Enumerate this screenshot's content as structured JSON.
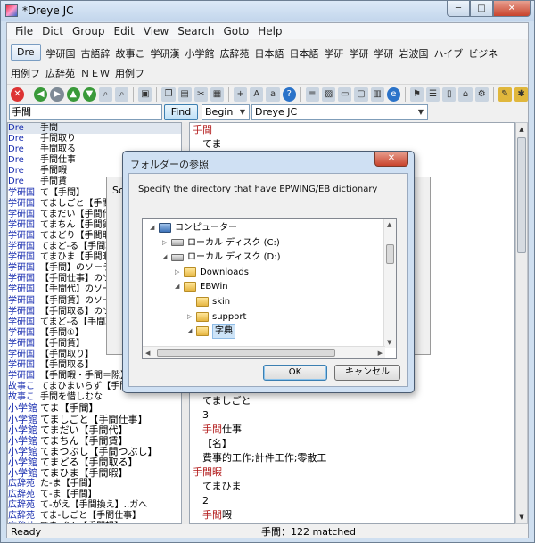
{
  "window": {
    "title": "*Dreye JC",
    "buttons": [
      "─",
      "□",
      "✕"
    ]
  },
  "menu": [
    "File",
    "Dict",
    "Group",
    "Edit",
    "View",
    "Search",
    "Goto",
    "Help"
  ],
  "dicts_line1": [
    "Dre",
    "学研国",
    "古語辞",
    "故事こ",
    "学研漢",
    "小学館",
    "広辞苑",
    "日本語",
    "日本語",
    "学研",
    "学研",
    "学研",
    "岩波国",
    "ハイブ",
    "ビジネ"
  ],
  "dicts_line2": [
    "用例フ",
    "広辞苑",
    "ＮＥＷ",
    "用例フ"
  ],
  "search": {
    "value": "手間",
    "find_label": "Find",
    "mode": "Begin",
    "dictionary": "Dreye JC"
  },
  "left_list": [
    {
      "d": "Dre",
      "w": "手間",
      "sel": true
    },
    {
      "d": "Dre",
      "w": "手間取り"
    },
    {
      "d": "Dre",
      "w": "手間取る"
    },
    {
      "d": "Dre",
      "w": "手間仕事"
    },
    {
      "d": "Dre",
      "w": "手間暇"
    },
    {
      "d": "Dre",
      "w": "手間賃"
    },
    {
      "d": "学研国",
      "w": "て【手間】"
    },
    {
      "d": "学研国",
      "w": "てましごと【手間仕事】"
    },
    {
      "d": "学研国",
      "w": "てまだい【手間代】"
    },
    {
      "d": "学研国",
      "w": "てまちん【手間賃】"
    },
    {
      "d": "学研国",
      "w": "てまどり【手間取り】"
    },
    {
      "d": "学研国",
      "w": "てまど-る【手間取る】"
    },
    {
      "d": "学研国",
      "w": "てまひま【手間暇・手間隙】"
    },
    {
      "d": "学研国",
      "w": "【手間】のソーラス"
    },
    {
      "d": "学研国",
      "w": "【手間仕事】のソ"
    },
    {
      "d": "学研国",
      "w": "【手間代】のソーラス"
    },
    {
      "d": "学研国",
      "w": "【手間賃】のソーラス"
    },
    {
      "d": "学研国",
      "w": "【手間取る】のソ"
    },
    {
      "d": "学研国",
      "w": "てまど-る【手間取る】"
    },
    {
      "d": "学研国",
      "w": "【手間①】"
    },
    {
      "d": "学研国",
      "w": "【手間賃】"
    },
    {
      "d": "学研国",
      "w": "【手間取り】"
    },
    {
      "d": "学研国",
      "w": "【手間取る】"
    },
    {
      "d": "学研国",
      "w": "【手間暇・手間＝隙】"
    },
    {
      "d": "故事こ",
      "w": "てまひまいらず【手間隙】"
    },
    {
      "d": "故事こ",
      "w": "手間を惜しむな"
    },
    {
      "d": "小学館",
      "w": "てま【手間】",
      "big": true
    },
    {
      "d": "小学館",
      "w": "てましごと【手間仕事】",
      "big": true
    },
    {
      "d": "小学館",
      "w": "てまだい【手間代】",
      "big": true
    },
    {
      "d": "小学館",
      "w": "てまちん【手間賃】",
      "big": true
    },
    {
      "d": "小学館",
      "w": "てまつぶし【手間つぶし】",
      "big": true
    },
    {
      "d": "小学館",
      "w": "てまどる【手間取る】",
      "big": true
    },
    {
      "d": "小学館",
      "w": "てまひま【手間暇】",
      "big": true
    },
    {
      "d": "広辞苑",
      "w": "た-ま【手間】"
    },
    {
      "d": "広辞苑",
      "w": "て-ま【手間】"
    },
    {
      "d": "広辞苑",
      "w": "て-がえ【手間換え】‥ガへ"
    },
    {
      "d": "広辞苑",
      "w": "てま-しごと【手間仕事】"
    },
    {
      "d": "広辞苑",
      "w": "てま-ぞん【手間損】"
    }
  ],
  "right_pane": [
    {
      "t": "head",
      "text": "手間"
    },
    {
      "t": "body",
      "text": "てま"
    },
    {
      "t": "spacer"
    },
    {
      "t": "spacer"
    },
    {
      "t": "spacer"
    },
    {
      "t": "spacer"
    },
    {
      "t": "spacer"
    },
    {
      "t": "spacer"
    },
    {
      "t": "spacer"
    },
    {
      "t": "spacer"
    },
    {
      "t": "spacer"
    },
    {
      "t": "spacer"
    },
    {
      "t": "spacer"
    },
    {
      "t": "spacer"
    },
    {
      "t": "spacer"
    },
    {
      "t": "spacer"
    },
    {
      "t": "spacer"
    },
    {
      "t": "spacer"
    },
    {
      "t": "spacer"
    },
    {
      "t": "body",
      "text": "てましごと"
    },
    {
      "t": "body",
      "text": "3"
    },
    {
      "t": "body",
      "parts": [
        [
          "手間",
          true
        ],
        [
          "仕事",
          false
        ]
      ]
    },
    {
      "t": "body",
      "text": "【名】"
    },
    {
      "t": "body",
      "text": "費事的工作;計件工作;零散工"
    },
    {
      "t": "head",
      "text": "手間暇"
    },
    {
      "t": "body",
      "text": "てまひま"
    },
    {
      "t": "body",
      "text": "2"
    },
    {
      "t": "body",
      "parts": [
        [
          "手間",
          true
        ],
        [
          "暇",
          false
        ]
      ]
    }
  ],
  "status": {
    "left": "Ready",
    "mid": "手間：122 matched"
  },
  "behind_dialog": {
    "title_fragment": "So"
  },
  "folder_dialog": {
    "title": "フォルダーの参照",
    "description": "Specify the directory that have EPWING/EB dictionary",
    "tree": [
      {
        "label": "コンピューター",
        "icon": "pc",
        "tri": "◢",
        "indent": 0
      },
      {
        "label": "ローカル ディスク (C:)",
        "icon": "drive",
        "tri": "▷",
        "indent": 1
      },
      {
        "label": "ローカル ディスク (D:)",
        "icon": "drive",
        "tri": "◢",
        "indent": 1
      },
      {
        "label": "Downloads",
        "icon": "folder",
        "tri": "▷",
        "indent": 2
      },
      {
        "label": "EBWin",
        "icon": "folder",
        "tri": "◢",
        "indent": 2
      },
      {
        "label": "skin",
        "icon": "folder",
        "tri": "",
        "indent": 3
      },
      {
        "label": "support",
        "icon": "folder",
        "tri": "▷",
        "indent": 3
      },
      {
        "label": "字典",
        "icon": "folder",
        "tri": "◢",
        "indent": 3,
        "sel": true
      }
    ],
    "ok_label": "OK",
    "cancel_label": "キャンセル"
  },
  "colors": {
    "accent": "#b21a1a",
    "dict_tag": "#1a2fb0",
    "selection": "#cde4f8"
  }
}
